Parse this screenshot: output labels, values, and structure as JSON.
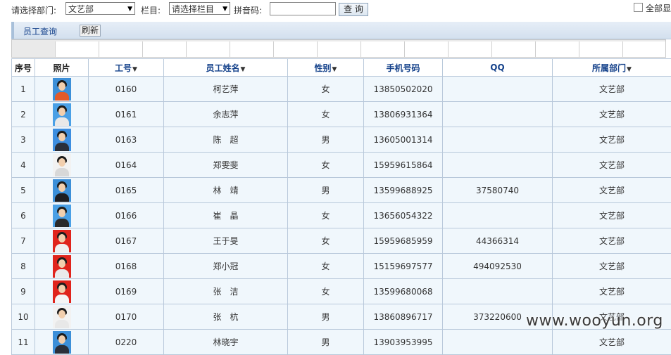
{
  "toolbar": {
    "dept_label": "请选择部门:",
    "dept_value": "文艺部",
    "column_label": "栏目:",
    "column_value": "请选择栏目",
    "pinyin_label": "拼音码:",
    "pinyin_value": "",
    "search_label": "查 询",
    "show_all_label": "全部显"
  },
  "tabs": {
    "query_label": "员工查询",
    "refresh_label": "刷新"
  },
  "table": {
    "headers": [
      "序号",
      "照片",
      "工号",
      "员工姓名",
      "性别",
      "手机号码",
      "QQ",
      "所属部门"
    ],
    "rows": [
      {
        "no": "1",
        "id": "0160",
        "name": "柯艺萍",
        "gender": "女",
        "phone": "13850502020",
        "qq": "",
        "dept": "文艺部",
        "photo_bg": "#3c8fd8",
        "body_color": "#e35a2a"
      },
      {
        "no": "2",
        "id": "0161",
        "name": "余志萍",
        "gender": "女",
        "phone": "13806931364",
        "qq": "",
        "dept": "文艺部",
        "photo_bg": "#4aa0e6",
        "body_color": "#e8e8e8"
      },
      {
        "no": "3",
        "id": "0163",
        "name": "陈　超",
        "gender": "男",
        "phone": "13605001314",
        "qq": "",
        "dept": "文艺部",
        "photo_bg": "#3d8ee0",
        "body_color": "#2a2f3a"
      },
      {
        "no": "4",
        "id": "0164",
        "name": "郑雯斐",
        "gender": "女",
        "phone": "15959615864",
        "qq": "",
        "dept": "文艺部",
        "photo_bg": "#f2f2f2",
        "body_color": "#d8d8d8"
      },
      {
        "no": "5",
        "id": "0165",
        "name": "林　靖",
        "gender": "男",
        "phone": "13599688925",
        "qq": "37580740",
        "dept": "文艺部",
        "photo_bg": "#3c8fd8",
        "body_color": "#1e1e22"
      },
      {
        "no": "6",
        "id": "0166",
        "name": "崔　晶",
        "gender": "女",
        "phone": "13656054322",
        "qq": "",
        "dept": "文艺部",
        "photo_bg": "#4aa0e6",
        "body_color": "#2a2a2a"
      },
      {
        "no": "7",
        "id": "0167",
        "name": "王于旻",
        "gender": "女",
        "phone": "15959685959",
        "qq": "44366314",
        "dept": "文艺部",
        "photo_bg": "#e0241c",
        "body_color": "#f0f0f0"
      },
      {
        "no": "8",
        "id": "0168",
        "name": "郑小冠",
        "gender": "女",
        "phone": "15159697577",
        "qq": "494092530",
        "dept": "文艺部",
        "photo_bg": "#e0241c",
        "body_color": "#eaeaea"
      },
      {
        "no": "9",
        "id": "0169",
        "name": "张　洁",
        "gender": "女",
        "phone": "13599680068",
        "qq": "",
        "dept": "文艺部",
        "photo_bg": "#e0241c",
        "body_color": "#f5f5f5"
      },
      {
        "no": "10",
        "id": "0170",
        "name": "张　杭",
        "gender": "男",
        "phone": "13860896717",
        "qq": "373220600",
        "dept": "文艺部",
        "photo_bg": "#f2f2f2",
        "body_color": "#e8e8e8"
      },
      {
        "no": "11",
        "id": "0220",
        "name": "林晓宇",
        "gender": "男",
        "phone": "13903953995",
        "qq": "",
        "dept": "文艺部",
        "photo_bg": "#3c8fd8",
        "body_color": "#2a2f3a"
      }
    ]
  },
  "watermark": "www.wooyun.org"
}
